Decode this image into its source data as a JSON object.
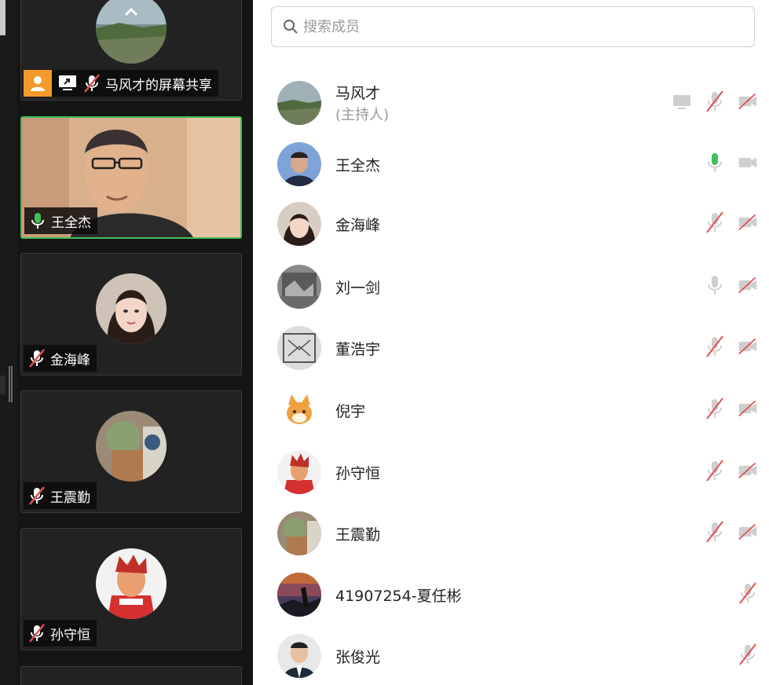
{
  "search": {
    "placeholder": "搜索成员"
  },
  "video_tiles": [
    {
      "name": "马风才的屏幕共享"
    },
    {
      "name": "王全杰"
    },
    {
      "name": "金海峰"
    },
    {
      "name": "王震勤"
    },
    {
      "name": "孙守恒"
    }
  ],
  "members": [
    {
      "name": "马风才",
      "role": "(主持人)",
      "screen_share": true,
      "mic": "muted",
      "camera": "off"
    },
    {
      "name": "王全杰",
      "mic": "active",
      "camera": "off-gray"
    },
    {
      "name": "金海峰",
      "mic": "muted",
      "camera": "off"
    },
    {
      "name": "刘一剑",
      "mic": "on-gray",
      "camera": "off"
    },
    {
      "name": "董浩宇",
      "mic": "muted",
      "camera": "off"
    },
    {
      "name": "倪宇",
      "mic": "muted",
      "camera": "off"
    },
    {
      "name": "孙守恒",
      "mic": "muted",
      "camera": "off"
    },
    {
      "name": "王震勤",
      "mic": "muted",
      "camera": "off"
    },
    {
      "name": "41907254-夏任彬",
      "mic": "muted"
    },
    {
      "name": "张俊光",
      "mic": "muted"
    }
  ],
  "colors": {
    "accent_green": "#3fbf5a",
    "host_orange": "#f39a2c",
    "muted_red": "#e05050"
  }
}
